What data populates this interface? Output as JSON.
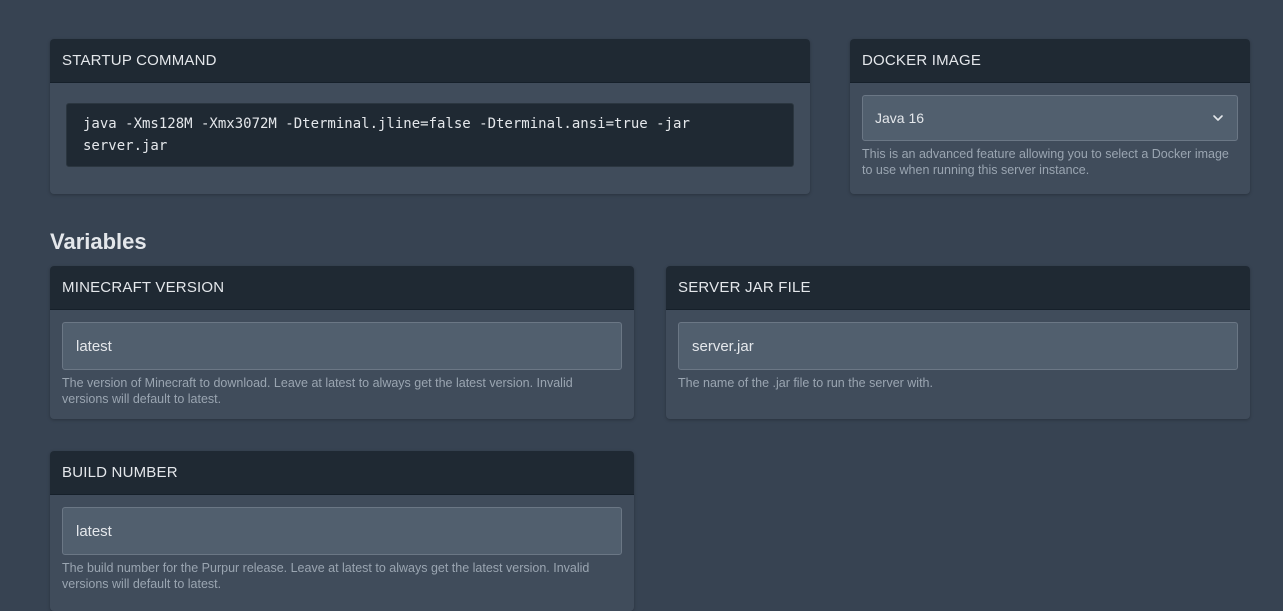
{
  "startup": {
    "title": "STARTUP COMMAND",
    "command": "java -Xms128M -Xmx3072M -Dterminal.jline=false -Dterminal.ansi=true -jar server.jar"
  },
  "docker": {
    "title": "DOCKER IMAGE",
    "selected": "Java 16",
    "help": "This is an advanced feature allowing you to select a Docker image to use when running this server instance."
  },
  "variables": {
    "heading": "Variables",
    "items": [
      {
        "title": "MINECRAFT VERSION",
        "value": "latest",
        "help": "The version of Minecraft to download. Leave at latest to always get the latest version. Invalid versions will default to latest."
      },
      {
        "title": "SERVER JAR FILE",
        "value": "server.jar",
        "help": "The name of the .jar file to run the server with."
      },
      {
        "title": "BUILD NUMBER",
        "value": "latest",
        "help": "The build number for the Purpur release. Leave at latest to always get the latest version. Invalid versions will default to latest."
      }
    ]
  },
  "icons": {
    "select_caret": "chevron-down-icon"
  }
}
